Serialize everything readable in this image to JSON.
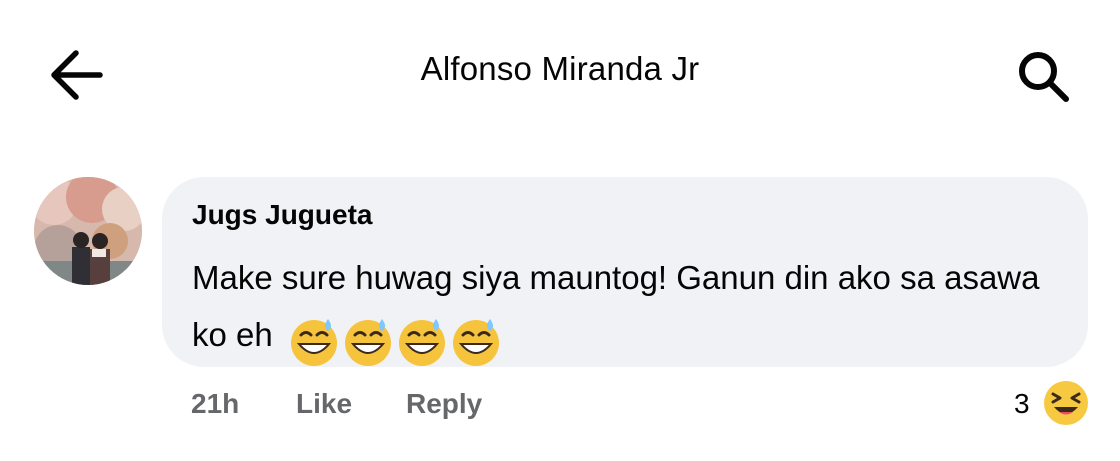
{
  "header": {
    "title": "Alfonso Miranda Jr"
  },
  "comment": {
    "author": "Jugs Jugueta",
    "text": "Make sure huwag siya mauntog! Ganun din ako sa asawa ko eh",
    "emojis": [
      "grinning-sweat-emoji",
      "grinning-sweat-emoji",
      "grinning-sweat-emoji",
      "grinning-sweat-emoji"
    ],
    "time": "21h",
    "like_label": "Like",
    "reply_label": "Reply",
    "reaction_count": "3",
    "reaction_icon": "laughing-reaction-icon"
  },
  "colors": {
    "bubble": "#f0f2f5",
    "meta_text": "#65676b",
    "emoji_yellow": "#f7c941",
    "sweat_blue": "#7ec8ff"
  }
}
